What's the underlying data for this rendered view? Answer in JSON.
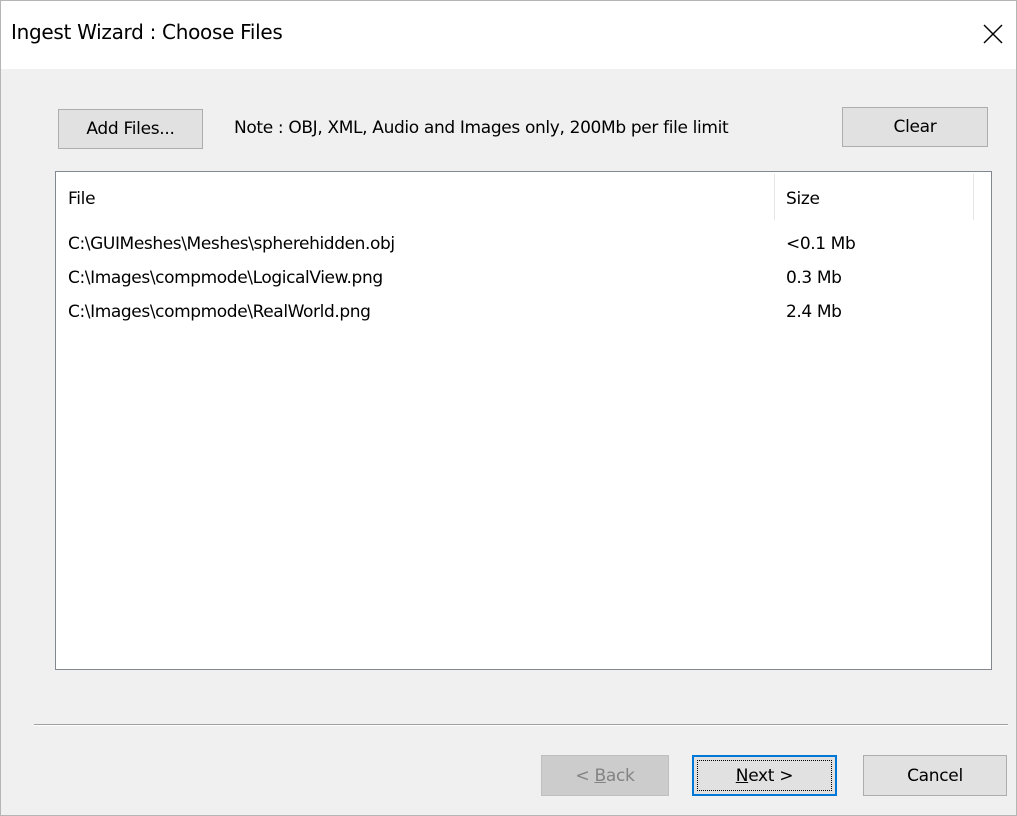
{
  "window": {
    "title": "Ingest Wizard : Choose Files"
  },
  "toolbar": {
    "add_files_label": "Add Files...",
    "note": "Note : OBJ, XML, Audio and Images only, 200Mb per file limit",
    "clear_label": "Clear"
  },
  "file_list": {
    "columns": [
      "File",
      "Size"
    ],
    "rows": [
      {
        "file": "C:\\GUIMeshes\\Meshes\\spherehidden.obj",
        "size": "<0.1 Mb"
      },
      {
        "file": "C:\\Images\\compmode\\LogicalView.png",
        "size": "0.3 Mb"
      },
      {
        "file": "C:\\Images\\compmode\\RealWorld.png",
        "size": "2.4 Mb"
      }
    ]
  },
  "footer": {
    "back_prefix": "< ",
    "back_mnemonic": "B",
    "back_rest": "ack",
    "next_mnemonic": "N",
    "next_rest": "ext >",
    "cancel_label": "Cancel"
  },
  "colors": {
    "default_button_border": "#0078d7",
    "dialog_background": "#f0f0f0"
  },
  "icons": {
    "close": "close-icon"
  }
}
